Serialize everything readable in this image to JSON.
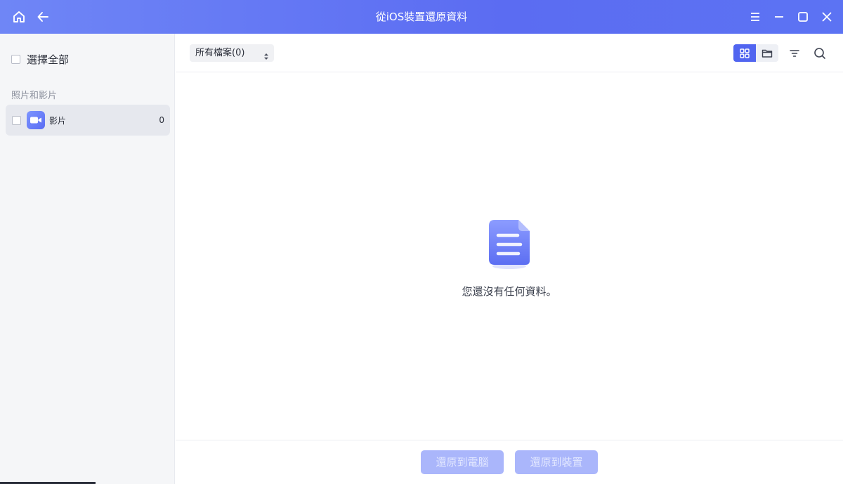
{
  "window": {
    "title": "從iOS裝置還原資料",
    "icons": {
      "home": "home-icon",
      "back": "back-arrow-icon",
      "menu": "menu-icon",
      "minimize": "minimize-icon",
      "maximize": "maximize-icon",
      "close": "close-icon"
    }
  },
  "sidebar": {
    "select_all_label": "選擇全部",
    "section_label": "照片和影片",
    "items": [
      {
        "label": "影片",
        "count": "0",
        "icon": "video-camera-icon"
      }
    ]
  },
  "toolbar": {
    "filter_value": "所有檔案(0)",
    "view_modes": [
      "grid-view-icon",
      "folder-view-icon"
    ],
    "active_view": "grid-view-icon",
    "icons": [
      "filter-icon",
      "search-icon"
    ]
  },
  "main": {
    "empty_message": "您還沒有任何資料。",
    "empty_icon": "document-icon"
  },
  "footer": {
    "restore_to_computer_label": "還原到電腦",
    "restore_to_device_label": "還原到裝置"
  },
  "colors": {
    "accent": "#5165f0",
    "titlebar_start": "#6f86f6",
    "titlebar_end": "#5b6cf2",
    "disabled_button": "#aab6fb"
  }
}
